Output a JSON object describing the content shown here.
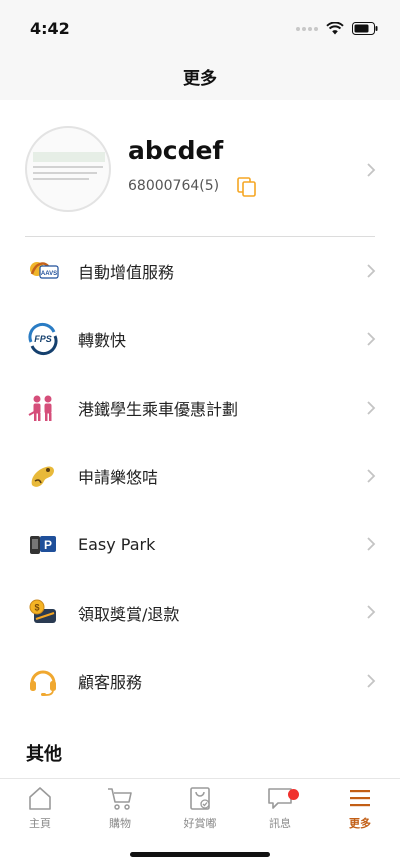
{
  "status": {
    "time": "4:42"
  },
  "nav": {
    "title": "更多"
  },
  "profile": {
    "name": "abcdef",
    "card_number": "68000764(5)"
  },
  "menu": [
    {
      "label": "自動增值服務",
      "icon": "aavs-icon"
    },
    {
      "label": "轉數快",
      "icon": "fps-icon"
    },
    {
      "label": "港鐵學生乘車優惠計劃",
      "icon": "student-icon"
    },
    {
      "label": "申請樂悠咭",
      "icon": "joyyou-card-icon"
    },
    {
      "label": "Easy Park",
      "icon": "parking-icon"
    },
    {
      "label": "領取獎賞/退款",
      "icon": "reward-refund-icon"
    },
    {
      "label": "顧客服務",
      "icon": "headset-icon"
    }
  ],
  "section": {
    "other": "其他"
  },
  "tabs": [
    {
      "label": "主頁",
      "icon": "home-icon"
    },
    {
      "label": "購物",
      "icon": "cart-icon"
    },
    {
      "label": "好賞嘟",
      "icon": "bag-icon"
    },
    {
      "label": "訊息",
      "icon": "message-icon"
    },
    {
      "label": "更多",
      "icon": "menu-icon"
    }
  ],
  "colors": {
    "accent": "#c25e15",
    "copy_icon": "#f5a623",
    "badge": "#f0312e"
  }
}
